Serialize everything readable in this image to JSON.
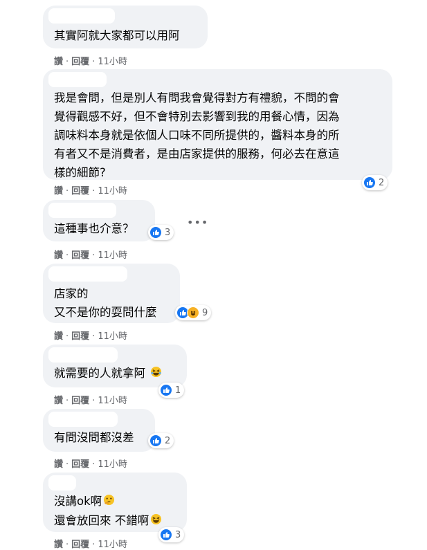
{
  "comments": [
    {
      "lines": [
        "其實阿就大家都可以用阿"
      ],
      "like": "讚",
      "reply": "回覆",
      "time": "11小時",
      "reaction_count": ""
    },
    {
      "lines": [
        "我是會問，但是別人有問我會覺得對方有禮貌，不問的會",
        "覺得觀感不好，但不會特別去影響到我的用餐心情，因為",
        "調味料本身就是依個人口味不同所提供的，醬料本身的所",
        "有者又不是消費者，是由店家提供的服務，何必去在意這",
        "樣的細節?"
      ],
      "like": "讚",
      "reply": "回覆",
      "time": "11小時",
      "reaction_count": "2"
    },
    {
      "lines": [
        "這種事也介意？"
      ],
      "like": "讚",
      "reply": "回覆",
      "time": "11小時",
      "reaction_count": "3"
    },
    {
      "lines": [
        "店家的",
        "又不是你的耍問什麼"
      ],
      "like": "讚",
      "reply": "回覆",
      "time": "11小時",
      "reaction_count": "9"
    },
    {
      "lines": [
        "就需要的人就拿阿"
      ],
      "like": "讚",
      "reply": "回覆",
      "time": "11小時",
      "reaction_count": "1"
    },
    {
      "lines": [
        "有問沒問都沒差"
      ],
      "like": "讚",
      "reply": "回覆",
      "time": "11小時",
      "reaction_count": "2"
    },
    {
      "lines": [
        "沒講ok啊",
        "還會放回來 不錯啊"
      ],
      "like": "讚",
      "reply": "回覆",
      "time": "11小時",
      "reaction_count": "3"
    }
  ],
  "colors": {
    "bubble": "#f0f2f5",
    "like_blue": "#1877f2",
    "meta_gray": "#65676b",
    "haha_yellow": "#f7b125"
  },
  "icons": [
    "like-icon",
    "haha-icon",
    "more-icon",
    "laughing-face-icon",
    "thinking-face-icon"
  ]
}
